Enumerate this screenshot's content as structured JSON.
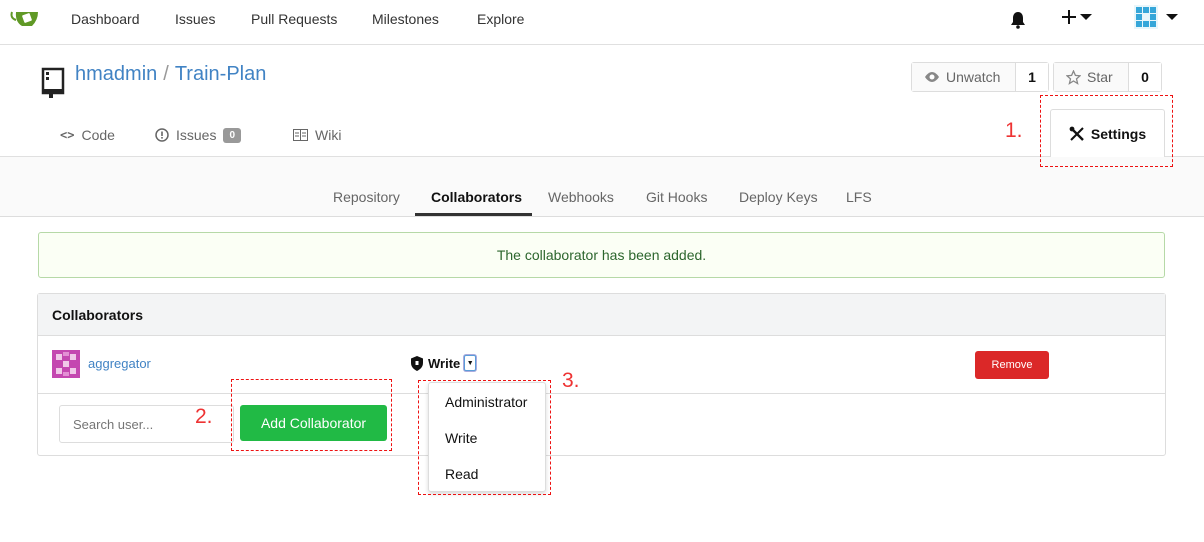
{
  "topnav": {
    "items": [
      "Dashboard",
      "Issues",
      "Pull Requests",
      "Milestones",
      "Explore"
    ],
    "plus_icon": "plus-icon",
    "bell_icon": "bell-icon"
  },
  "repo": {
    "owner": "hmadmin",
    "separator": "/",
    "name": "Train-Plan",
    "watch_label": "Unwatch",
    "watch_count": "1",
    "star_label": "Star",
    "star_count": "0",
    "tabs": {
      "code": "Code",
      "issues": "Issues",
      "issues_count": "0",
      "wiki": "Wiki",
      "settings": "Settings"
    }
  },
  "subnav": {
    "tabs": [
      "Repository",
      "Collaborators",
      "Webhooks",
      "Git Hooks",
      "Deploy Keys",
      "LFS"
    ],
    "active": "Collaborators"
  },
  "flash": {
    "message": "The collaborator has been added."
  },
  "panel": {
    "title": "Collaborators",
    "collaborator": {
      "username": "aggregator",
      "permission": "Write",
      "remove_label": "Remove"
    },
    "search_placeholder": "Search user...",
    "add_label": "Add Collaborator"
  },
  "dropdown": {
    "options": [
      "Administrator",
      "Write",
      "Read"
    ]
  },
  "annotations": {
    "step1": "1.",
    "step2": "2.",
    "step3": "3."
  },
  "colors": {
    "link": "#4183c4",
    "primary_green": "#21ba45",
    "danger_red": "#db2828",
    "annotation_red": "#e11"
  }
}
